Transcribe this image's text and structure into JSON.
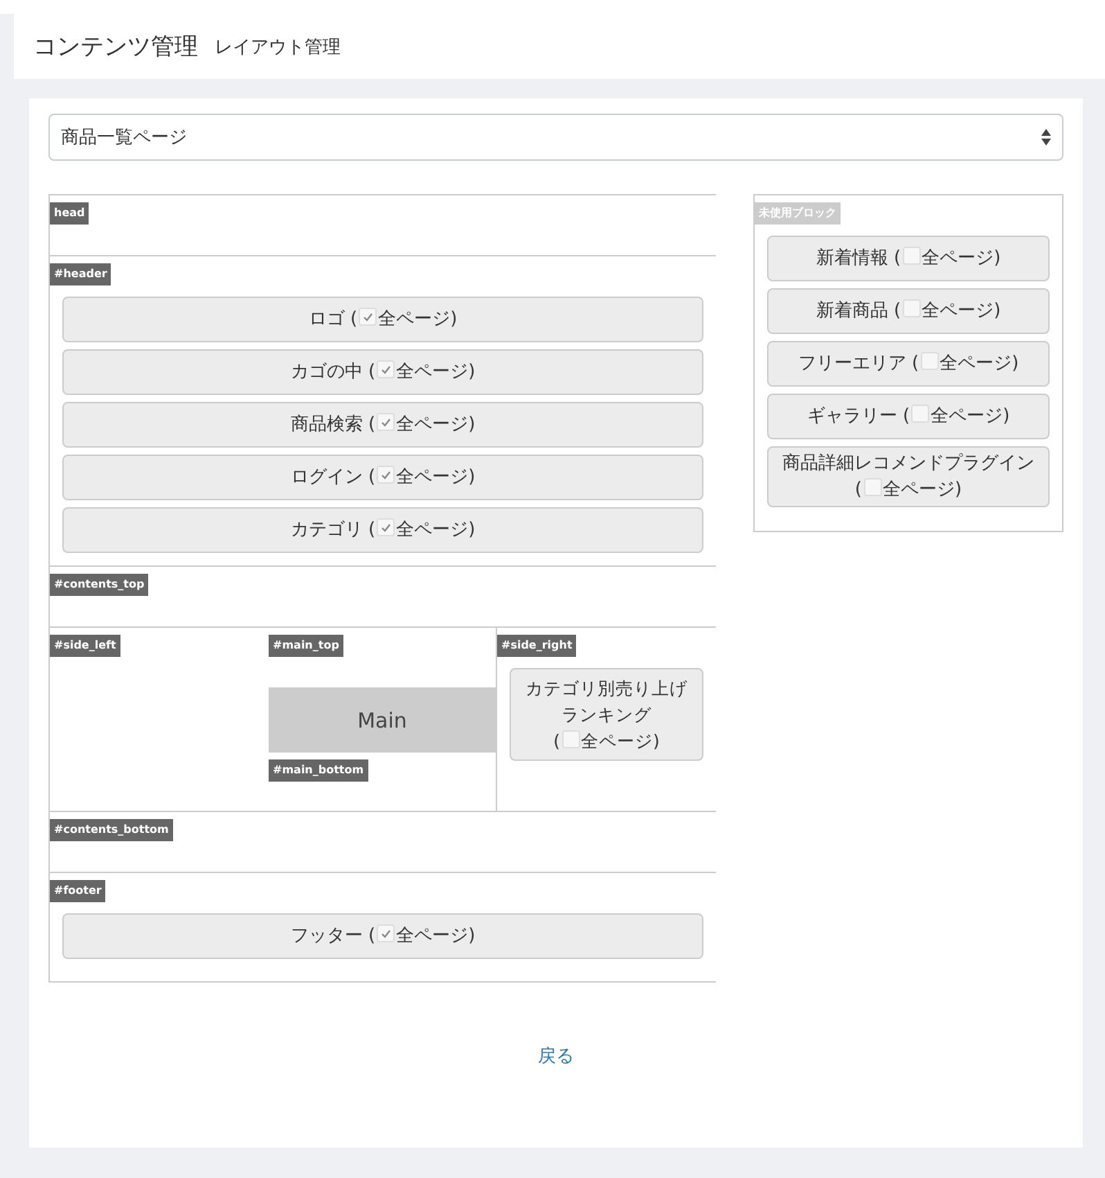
{
  "breadcrumb": {
    "title": "コンテンツ管理",
    "subtitle": "レイアウト管理"
  },
  "page_select": {
    "value": "商品一覧ページ"
  },
  "layout": {
    "head": {
      "label": "head"
    },
    "header": {
      "label": "#header",
      "blocks": [
        {
          "name": "ロゴ",
          "open": "(",
          "scope": "全ページ)",
          "checked": true
        },
        {
          "name": "カゴの中",
          "open": "(",
          "scope": "全ページ)",
          "checked": true
        },
        {
          "name": "商品検索",
          "open": "(",
          "scope": "全ページ)",
          "checked": true
        },
        {
          "name": "ログイン",
          "open": "(",
          "scope": "全ページ)",
          "checked": true
        },
        {
          "name": "カテゴリ",
          "open": "(",
          "scope": "全ページ)",
          "checked": true
        }
      ]
    },
    "contents_top": {
      "label": "#contents_top"
    },
    "side_left": {
      "label": "#side_left"
    },
    "main_top": {
      "label": "#main_top"
    },
    "main": {
      "label": "Main"
    },
    "main_bottom": {
      "label": "#main_bottom"
    },
    "side_right": {
      "label": "#side_right",
      "blocks": [
        {
          "name": "カテゴリ別売り上げランキング",
          "open": "(",
          "scope": "全ページ)",
          "checked": false
        }
      ]
    },
    "contents_bottom": {
      "label": "#contents_bottom"
    },
    "footer": {
      "label": "#footer",
      "blocks": [
        {
          "name": "フッター",
          "open": "(",
          "scope": "全ページ)",
          "checked": true
        }
      ]
    }
  },
  "unused": {
    "label": "未使用ブロック",
    "blocks": [
      {
        "name": "新着情報",
        "open": "(",
        "scope": "全ページ)",
        "checked": false
      },
      {
        "name": "新着商品",
        "open": "(",
        "scope": "全ページ)",
        "checked": false
      },
      {
        "name": "フリーエリア",
        "open": "(",
        "scope": "全ページ)",
        "checked": false
      },
      {
        "name": "ギャラリー",
        "open": "(",
        "scope": "全ページ)",
        "checked": false
      },
      {
        "name": "商品詳細レコメンドプラグイン",
        "open": "(",
        "scope": "全ページ)",
        "checked": false
      }
    ]
  },
  "back_link": "戻る"
}
